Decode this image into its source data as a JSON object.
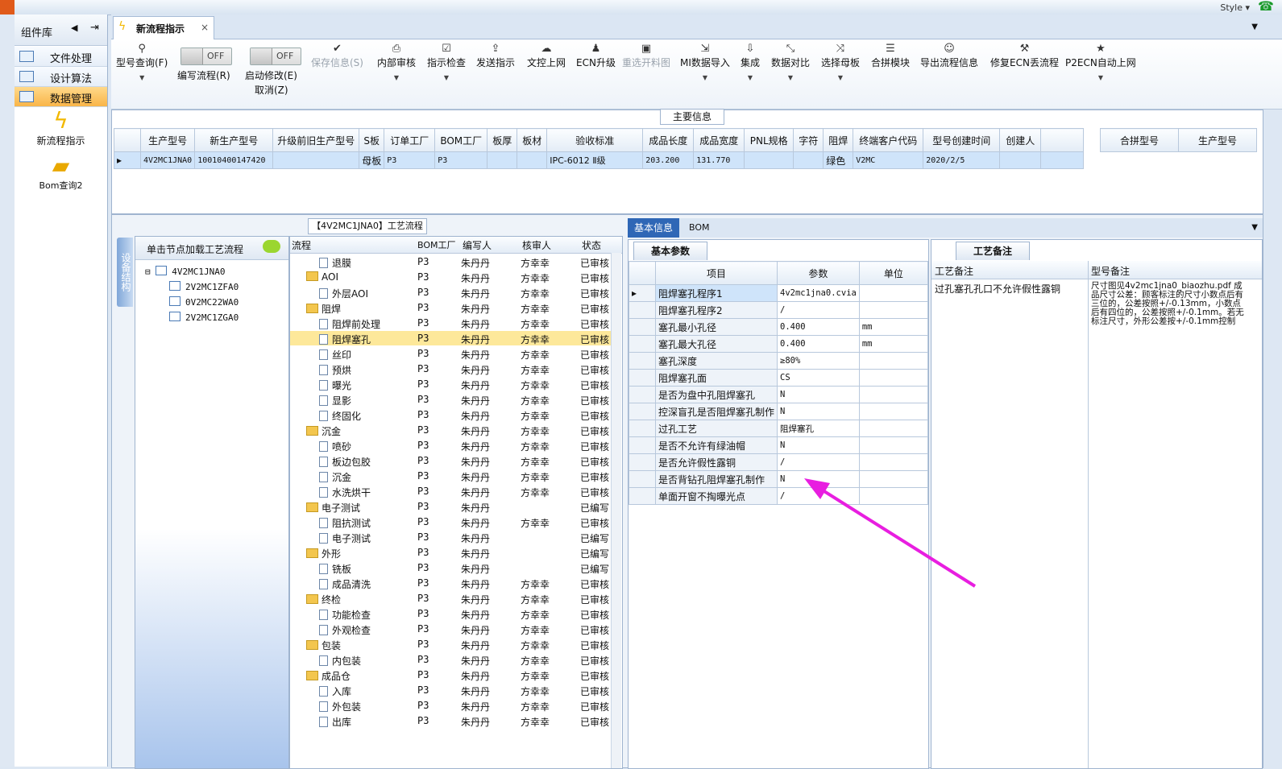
{
  "app": {
    "style_label": "Style ▾"
  },
  "components": {
    "title": "组件库",
    "items": [
      {
        "label": "文件处理"
      },
      {
        "label": "设计算法"
      },
      {
        "label": "数据管理"
      }
    ],
    "big_items": [
      {
        "label": "新流程指示"
      },
      {
        "label": "Bom查询2"
      }
    ]
  },
  "doc_tab": {
    "title": "新流程指示",
    "close": "×"
  },
  "toolbar": {
    "type_query": "型号查询(F)",
    "edit_flow_toggle": "OFF",
    "edit_flow": "编写流程(R)",
    "auto_modify_toggle": "OFF",
    "auto_modify": "启动修改(E)",
    "cancel": "取消(Z)",
    "save_info": "保存信息(S)",
    "internal_review": "内部审核",
    "instruction_check": "指示检查",
    "send_instruction": "发送指示",
    "doc_upload": "文控上网",
    "ecn_upgrade": "ECN升级",
    "select_drawing": "重选开料图",
    "mi_import": "MI数据导入",
    "integrate": "集成",
    "data_compare": "数据对比",
    "select_master": "选择母板",
    "merge_module": "合拼模块",
    "export_flow": "导出流程信息",
    "fix_ecn": "修复ECN丢流程",
    "p2ecn": "P2ECN自动上网"
  },
  "main_info": {
    "caption": "主要信息",
    "headers": [
      "生产型号",
      "新生产型号",
      "升级前旧生产型号",
      "S板",
      "订单工厂",
      "BOM工厂",
      "板厚",
      "板材",
      "验收标准",
      "成品长度",
      "成品宽度",
      "PNL规格",
      "字符",
      "阻焊",
      "终端客户代码",
      "型号创建时间",
      "创建人"
    ],
    "row": [
      "4V2MC1JNA0",
      "10010400147420",
      "",
      "母板",
      "P3",
      "P3",
      "",
      "",
      "IPC-6012 Ⅱ级",
      "203.200",
      "131.770",
      "",
      "",
      "绿色",
      "V2MC",
      "2020/2/5",
      ""
    ],
    "side_headers": [
      "合拼型号",
      "生产型号"
    ]
  },
  "flow": {
    "caption": "【4V2MC1JNA0】工艺流程",
    "vertical_tab": "设备结构",
    "tree_title": "单击节点加载工艺流程",
    "tree_root": "4V2MC1JNA0",
    "tree_children": [
      "2V2MC1ZFA0",
      "0V2MC22WA0",
      "2V2MC1ZGA0"
    ],
    "headers": [
      "流程",
      "BOM工厂",
      "编写人",
      "核审人",
      "状态"
    ],
    "rows": [
      {
        "name": "退膜",
        "lvl": 2,
        "f": "P3",
        "w": "朱丹丹",
        "r": "方幸幸",
        "s": "已审核"
      },
      {
        "name": "AOI",
        "lvl": 1,
        "f": "P3",
        "w": "朱丹丹",
        "r": "方幸幸",
        "s": "已审核"
      },
      {
        "name": "外层AOI",
        "lvl": 2,
        "f": "P3",
        "w": "朱丹丹",
        "r": "方幸幸",
        "s": "已审核"
      },
      {
        "name": "阻焊",
        "lvl": 1,
        "f": "P3",
        "w": "朱丹丹",
        "r": "方幸幸",
        "s": "已审核"
      },
      {
        "name": "阻焊前处理",
        "lvl": 2,
        "f": "P3",
        "w": "朱丹丹",
        "r": "方幸幸",
        "s": "已审核"
      },
      {
        "name": "阻焊塞孔",
        "lvl": 2,
        "f": "P3",
        "w": "朱丹丹",
        "r": "方幸幸",
        "s": "已审核",
        "sel": true
      },
      {
        "name": "丝印",
        "lvl": 2,
        "f": "P3",
        "w": "朱丹丹",
        "r": "方幸幸",
        "s": "已审核"
      },
      {
        "name": "预烘",
        "lvl": 2,
        "f": "P3",
        "w": "朱丹丹",
        "r": "方幸幸",
        "s": "已审核"
      },
      {
        "name": "曝光",
        "lvl": 2,
        "f": "P3",
        "w": "朱丹丹",
        "r": "方幸幸",
        "s": "已审核"
      },
      {
        "name": "显影",
        "lvl": 2,
        "f": "P3",
        "w": "朱丹丹",
        "r": "方幸幸",
        "s": "已审核"
      },
      {
        "name": "终固化",
        "lvl": 2,
        "f": "P3",
        "w": "朱丹丹",
        "r": "方幸幸",
        "s": "已审核"
      },
      {
        "name": "沉金",
        "lvl": 1,
        "f": "P3",
        "w": "朱丹丹",
        "r": "方幸幸",
        "s": "已审核"
      },
      {
        "name": "喷砂",
        "lvl": 2,
        "f": "P3",
        "w": "朱丹丹",
        "r": "方幸幸",
        "s": "已审核"
      },
      {
        "name": "板边包胶",
        "lvl": 2,
        "f": "P3",
        "w": "朱丹丹",
        "r": "方幸幸",
        "s": "已审核"
      },
      {
        "name": "沉金",
        "lvl": 2,
        "f": "P3",
        "w": "朱丹丹",
        "r": "方幸幸",
        "s": "已审核"
      },
      {
        "name": "水洗烘干",
        "lvl": 2,
        "f": "P3",
        "w": "朱丹丹",
        "r": "方幸幸",
        "s": "已审核"
      },
      {
        "name": "电子测试",
        "lvl": 1,
        "f": "P3",
        "w": "朱丹丹",
        "r": "",
        "s": "已编写"
      },
      {
        "name": "阻抗测试",
        "lvl": 2,
        "f": "P3",
        "w": "朱丹丹",
        "r": "方幸幸",
        "s": "已审核"
      },
      {
        "name": "电子测试",
        "lvl": 2,
        "f": "P3",
        "w": "朱丹丹",
        "r": "",
        "s": "已编写"
      },
      {
        "name": "外形",
        "lvl": 1,
        "f": "P3",
        "w": "朱丹丹",
        "r": "",
        "s": "已编写"
      },
      {
        "name": "铣板",
        "lvl": 2,
        "f": "P3",
        "w": "朱丹丹",
        "r": "",
        "s": "已编写"
      },
      {
        "name": "成品清洗",
        "lvl": 2,
        "f": "P3",
        "w": "朱丹丹",
        "r": "方幸幸",
        "s": "已审核"
      },
      {
        "name": "终检",
        "lvl": 1,
        "f": "P3",
        "w": "朱丹丹",
        "r": "方幸幸",
        "s": "已审核"
      },
      {
        "name": "功能检查",
        "lvl": 2,
        "f": "P3",
        "w": "朱丹丹",
        "r": "方幸幸",
        "s": "已审核"
      },
      {
        "name": "外观检查",
        "lvl": 2,
        "f": "P3",
        "w": "朱丹丹",
        "r": "方幸幸",
        "s": "已审核"
      },
      {
        "name": "包装",
        "lvl": 1,
        "f": "P3",
        "w": "朱丹丹",
        "r": "方幸幸",
        "s": "已审核"
      },
      {
        "name": "内包装",
        "lvl": 2,
        "f": "P3",
        "w": "朱丹丹",
        "r": "方幸幸",
        "s": "已审核"
      },
      {
        "name": "成品仓",
        "lvl": 1,
        "f": "P3",
        "w": "朱丹丹",
        "r": "方幸幸",
        "s": "已审核"
      },
      {
        "name": "入库",
        "lvl": 2,
        "f": "P3",
        "w": "朱丹丹",
        "r": "方幸幸",
        "s": "已审核"
      },
      {
        "name": "外包装",
        "lvl": 2,
        "f": "P3",
        "w": "朱丹丹",
        "r": "方幸幸",
        "s": "已审核"
      },
      {
        "name": "出库",
        "lvl": 2,
        "f": "P3",
        "w": "朱丹丹",
        "r": "方幸幸",
        "s": "已审核"
      }
    ]
  },
  "right_tabs": {
    "basic": "基本信息",
    "bom": "BOM"
  },
  "params": {
    "tab": "基本参数",
    "headers": [
      "项目",
      "参数",
      "单位"
    ],
    "rows": [
      [
        "阻焊塞孔程序1",
        "4v2mc1jna0.cvia",
        ""
      ],
      [
        "阻焊塞孔程序2",
        "/",
        ""
      ],
      [
        "塞孔最小孔径",
        "0.400",
        "mm"
      ],
      [
        "塞孔最大孔径",
        "0.400",
        "mm"
      ],
      [
        "塞孔深度",
        "≥80%",
        ""
      ],
      [
        "阻焊塞孔面",
        "CS",
        ""
      ],
      [
        "是否为盘中孔阻焊塞孔",
        "N",
        ""
      ],
      [
        "控深盲孔是否阻焊塞孔制作",
        "N",
        ""
      ],
      [
        "过孔工艺",
        "阻焊塞孔",
        ""
      ],
      [
        "是否不允许有绿油帽",
        "N",
        ""
      ],
      [
        "是否允许假性露铜",
        "/",
        ""
      ],
      [
        "是否背钻孔阻焊塞孔制作",
        "N",
        ""
      ],
      [
        "单面开窗不掏曝光点",
        "/",
        ""
      ]
    ]
  },
  "remarks": {
    "tab": "工艺备注",
    "col1": "工艺备注",
    "col2": "型号备注",
    "text1": "过孔塞孔孔口不允许假性露铜",
    "text2": "尺寸图见4v2mc1jna0_biaozhu.pdf 成品尺寸公差：顾客标注的尺寸小数点后有三位的，公差按照+/-0.13mm，小数点后有四位的，公差按照+/-0.1mm。若无标注尺寸，外形公差按+/-0.1mm控制"
  },
  "colors": {
    "accent": "#2f67b6",
    "selected_row": "#fde89a",
    "arrow": "#e81ee0"
  }
}
